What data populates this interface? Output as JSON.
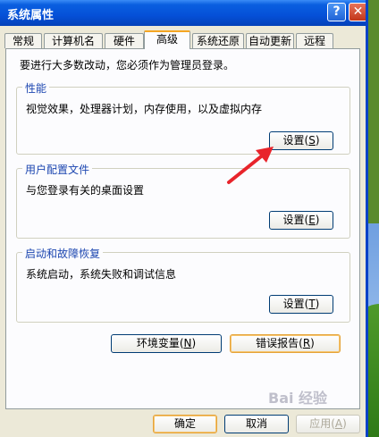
{
  "window": {
    "title": "系统属性",
    "help": "?",
    "close": "✕"
  },
  "tabs": [
    {
      "label": "常规"
    },
    {
      "label": "计算机名"
    },
    {
      "label": "硬件"
    },
    {
      "label": "高级"
    },
    {
      "label": "系统还原"
    },
    {
      "label": "自动更新"
    },
    {
      "label": "远程"
    }
  ],
  "active_tab": "高级",
  "intro": "要进行大多数改动，您必须作为管理员登录。",
  "performance": {
    "title": "性能",
    "description": "视觉效果，处理器计划，内存使用，以及虚拟内存",
    "button": "设置",
    "key": "S"
  },
  "user_profiles": {
    "title": "用户配置文件",
    "description": "与您登录有关的桌面设置",
    "button": "设置",
    "key": "E"
  },
  "startup_recovery": {
    "title": "启动和故障恢复",
    "description": "系统启动，系统失败和调试信息",
    "button": "设置",
    "key": "T"
  },
  "env_button": {
    "label": "环境变量",
    "key": "N"
  },
  "error_button": {
    "label": "错误报告",
    "key": "R"
  },
  "footer": {
    "ok": "确定",
    "cancel": "取消",
    "apply": "应用",
    "apply_key": "A"
  },
  "watermark": "Bai 经验",
  "colors": {
    "titlebar": "#0550d8",
    "accent_tab": "#f5a623",
    "arrow": "#e8242b",
    "group_title": "#1c46b0"
  }
}
